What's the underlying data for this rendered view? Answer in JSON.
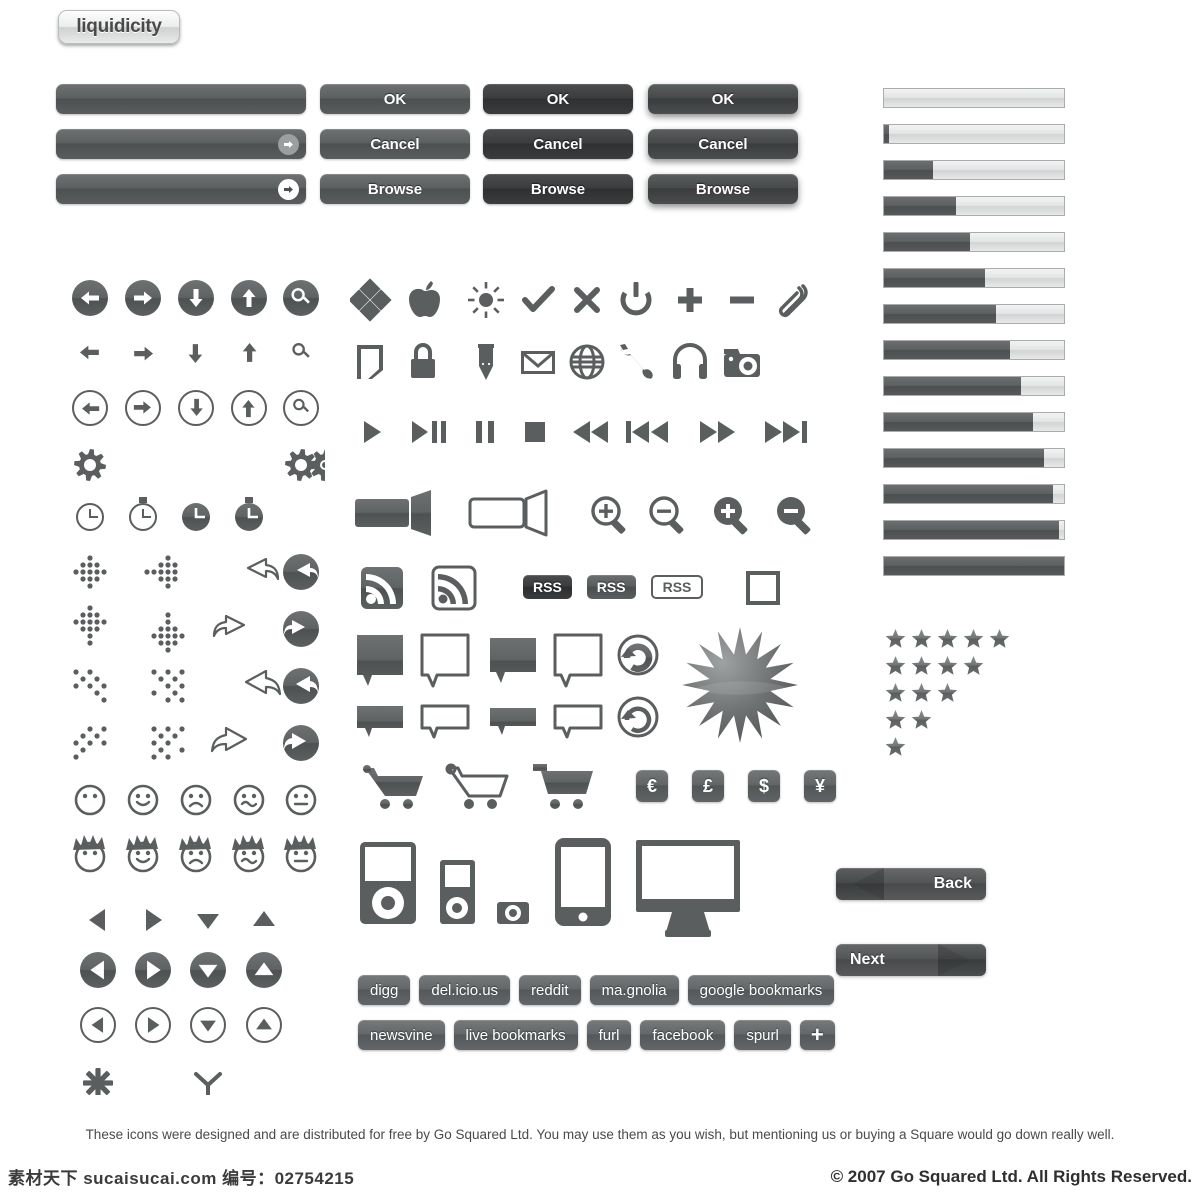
{
  "brand": {
    "logo_label": "liquidicity"
  },
  "input_bars": [
    {
      "name": "input-bar-plain",
      "arrow": "none"
    },
    {
      "name": "input-bar-soft-arrow",
      "arrow": "soft",
      "icon": "arrow-right-circle-icon"
    },
    {
      "name": "input-bar-white-arrow",
      "arrow": "hard",
      "icon": "arrow-right-circle-icon"
    }
  ],
  "button_sets": [
    {
      "style": "medium",
      "labels": [
        "OK",
        "Cancel",
        "Browse"
      ]
    },
    {
      "style": "dark",
      "labels": [
        "OK",
        "Cancel",
        "Browse"
      ]
    },
    {
      "style": "dark-shadow",
      "labels": [
        "OK",
        "Cancel",
        "Browse"
      ]
    }
  ],
  "progress_bars": {
    "label": "progress-bar-set",
    "count": 14,
    "percents": [
      0,
      3,
      27,
      40,
      48,
      56,
      62,
      70,
      76,
      83,
      89,
      94,
      97,
      100
    ]
  },
  "stars": {
    "label": "star-rating-pyramid",
    "rows": [
      5,
      4,
      3,
      2,
      1
    ]
  },
  "nav_buttons": [
    {
      "label": "Back",
      "direction": "left"
    },
    {
      "label": "Next",
      "direction": "right"
    }
  ],
  "currency_keys": [
    {
      "symbol": "€",
      "name": "euro-key"
    },
    {
      "symbol": "£",
      "name": "pound-key"
    },
    {
      "symbol": "$",
      "name": "dollar-key"
    },
    {
      "symbol": "¥",
      "name": "yen-key"
    }
  ],
  "rss_pills": [
    {
      "label": "RSS",
      "style": "dark"
    },
    {
      "label": "RSS",
      "style": "mid"
    },
    {
      "label": "RSS",
      "style": "outline"
    }
  ],
  "social_buttons": {
    "row1": [
      "digg",
      "del.icio.us",
      "reddit",
      "ma.gnolia",
      "google bookmarks"
    ],
    "row2": [
      "newsvine",
      "live bookmarks",
      "furl",
      "facebook",
      "spurl",
      "+"
    ]
  },
  "icon_names": {
    "arrows_filled_circle": [
      "arrow-left-circle-icon",
      "arrow-right-circle-icon",
      "arrow-down-circle-icon",
      "arrow-up-circle-icon",
      "search-circle-icon"
    ],
    "arrows_plain": [
      "arrow-left-icon",
      "arrow-right-icon",
      "arrow-down-icon",
      "arrow-up-icon",
      "search-icon"
    ],
    "arrows_outline_circle": [
      "arrow-left-outline-circle-icon",
      "arrow-right-outline-circle-icon",
      "arrow-down-outline-circle-icon",
      "arrow-up-outline-circle-icon",
      "search-outline-circle-icon"
    ],
    "gears": [
      "gear-icon",
      "gear-small-icon",
      "gear-ring-icon"
    ],
    "clocks": [
      "clock-outline-icon",
      "timer-outline-icon",
      "clock-filled-icon",
      "timer-filled-icon"
    ],
    "cursors": [
      "dotted-cross-move-icon",
      "dotted-cross-right-icon",
      "reply-outline-icon",
      "reply-filled-circle-icon",
      "dotted-cross-up-icon",
      "dotted-cross-down-icon",
      "forward-outline-icon",
      "forward-filled-circle-icon",
      "dotted-diagonal-nw-icon",
      "dotted-diagonal-ne-icon",
      "reply-wide-outline-icon",
      "reply-wide-filled-icon",
      "dotted-diagonal-sw-icon",
      "dotted-diagonal-se-icon",
      "forward-wide-outline-icon",
      "forward-wide-filled-icon"
    ],
    "faces": [
      "face-neutral-icon",
      "face-happy-icon",
      "face-sad-icon",
      "face-confused-icon",
      "face-flat-icon"
    ],
    "faces_hair": [
      "face-hair-neutral-icon",
      "face-hair-happy-icon",
      "face-hair-sad-icon",
      "face-hair-confused-icon",
      "face-hair-flat-icon"
    ],
    "triangles": [
      "triangle-left-icon",
      "triangle-right-icon",
      "triangle-down-icon",
      "triangle-up-icon"
    ],
    "triangles_filled_circle": [
      "triangle-left-circle-icon",
      "triangle-right-circle-icon",
      "triangle-down-circle-icon",
      "triangle-up-circle-icon"
    ],
    "triangles_outline_circle": [
      "triangle-left-outline-circle-icon",
      "triangle-right-outline-circle-icon",
      "triangle-down-outline-circle-icon",
      "triangle-up-outline-circle-icon"
    ],
    "misc_bottom": [
      "asterisk-icon",
      "mercedes-icon"
    ],
    "row_symbols": [
      "diamond-grid-icon",
      "apple-icon",
      "brightness-icon",
      "check-icon",
      "close-x-icon",
      "power-icon",
      "plus-icon",
      "minus-icon",
      "paperclip-icon"
    ],
    "row_objects": [
      "document-icon",
      "lock-icon",
      "pen-icon",
      "mail-icon",
      "globe-icon",
      "wrench-icon",
      "headphones-icon",
      "camera-icon"
    ],
    "media": [
      "play-icon",
      "play-pause-icon",
      "pause-icon",
      "stop-icon",
      "rewind-icon",
      "skip-back-icon",
      "fast-forward-icon",
      "skip-forward-icon"
    ],
    "video_zoom": [
      "video-camera-filled-icon",
      "video-camera-outline-icon",
      "zoom-in-outline-icon",
      "zoom-out-outline-icon",
      "zoom-in-filled-icon",
      "zoom-out-filled-icon"
    ],
    "rss": [
      "rss-filled-icon",
      "rss-outline-icon",
      "checkbox-empty-icon"
    ],
    "bubbles": [
      "speech-bubble-filled-tall-icon",
      "speech-bubble-outline-tall-icon",
      "speech-bubble-filled-tall-2-icon",
      "speech-bubble-outline-tall-2-icon",
      "refresh-filled-icon",
      "starburst-icon",
      "speech-bubble-filled-wide-icon",
      "speech-bubble-outline-wide-icon",
      "speech-bubble-filled-wide-2-icon",
      "speech-bubble-outline-wide-icon-2",
      "refresh-outline-icon"
    ],
    "carts": [
      "cart-filled-icon",
      "cart-outline-icon",
      "cart-filled-flag-icon"
    ],
    "devices": [
      "ipod-classic-icon",
      "ipod-nano-icon",
      "ipod-shuffle-icon",
      "iphone-icon",
      "imac-icon"
    ]
  },
  "footer": {
    "note": "These icons were designed and are distributed for free by Go Squared Ltd. You may use them as you wish, but mentioning us or buying a Square would go down really well.",
    "watermark": "素材天下 sucaisucai.com 编号：02754215",
    "copyright": "© 2007 Go Squared Ltd. All Rights Reserved."
  },
  "colors": {
    "icon_gray": "#5b5e5f",
    "surface_mid": "#5d6061",
    "surface_dark": "#3a3c3d",
    "progress_track": "#e3e4e4",
    "page_bg": "#ffffff"
  }
}
